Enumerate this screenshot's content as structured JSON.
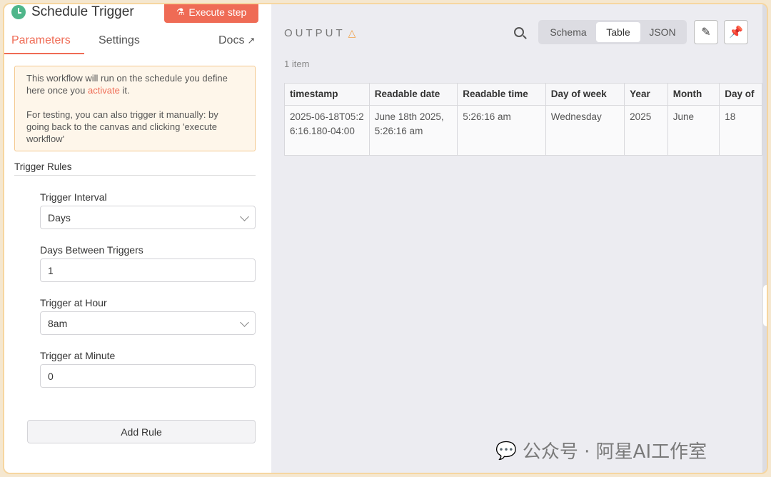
{
  "node": {
    "title": "Schedule Trigger",
    "execute_label": "Execute step"
  },
  "tabs": {
    "parameters": "Parameters",
    "settings": "Settings",
    "docs": "Docs"
  },
  "notice": {
    "line1_before": "This workflow will run on the schedule you define here once you ",
    "line1_link": "activate",
    "line1_after": " it.",
    "line2": "For testing, you can also trigger it manually: by going back to the canvas and clicking 'execute workflow'"
  },
  "rules": {
    "section_title": "Trigger Rules",
    "interval_label": "Trigger Interval",
    "interval_value": "Days",
    "days_between_label": "Days Between Triggers",
    "days_between_value": "1",
    "hour_label": "Trigger at Hour",
    "hour_value": "8am",
    "minute_label": "Trigger at Minute",
    "minute_value": "0",
    "add_rule_label": "Add Rule"
  },
  "output": {
    "title": "OUTPUT",
    "item_count": "1 item",
    "views": [
      "Schema",
      "Table",
      "JSON"
    ],
    "selected_view": "Table",
    "columns": [
      "timestamp",
      "Readable date",
      "Readable time",
      "Day of week",
      "Year",
      "Month",
      "Day of"
    ],
    "rows": [
      [
        "2025-06-18T05:26:16.180-04:00",
        "June 18th 2025, 5:26:16 am",
        "5:26:16 am",
        "Wednesday",
        "2025",
        "June",
        "18"
      ]
    ]
  },
  "watermark": "公众号 · 阿星AI工作室",
  "colors": {
    "accent": "#ef6b55",
    "warning": "#f0a047",
    "trigger_icon": "#4fb68a"
  }
}
